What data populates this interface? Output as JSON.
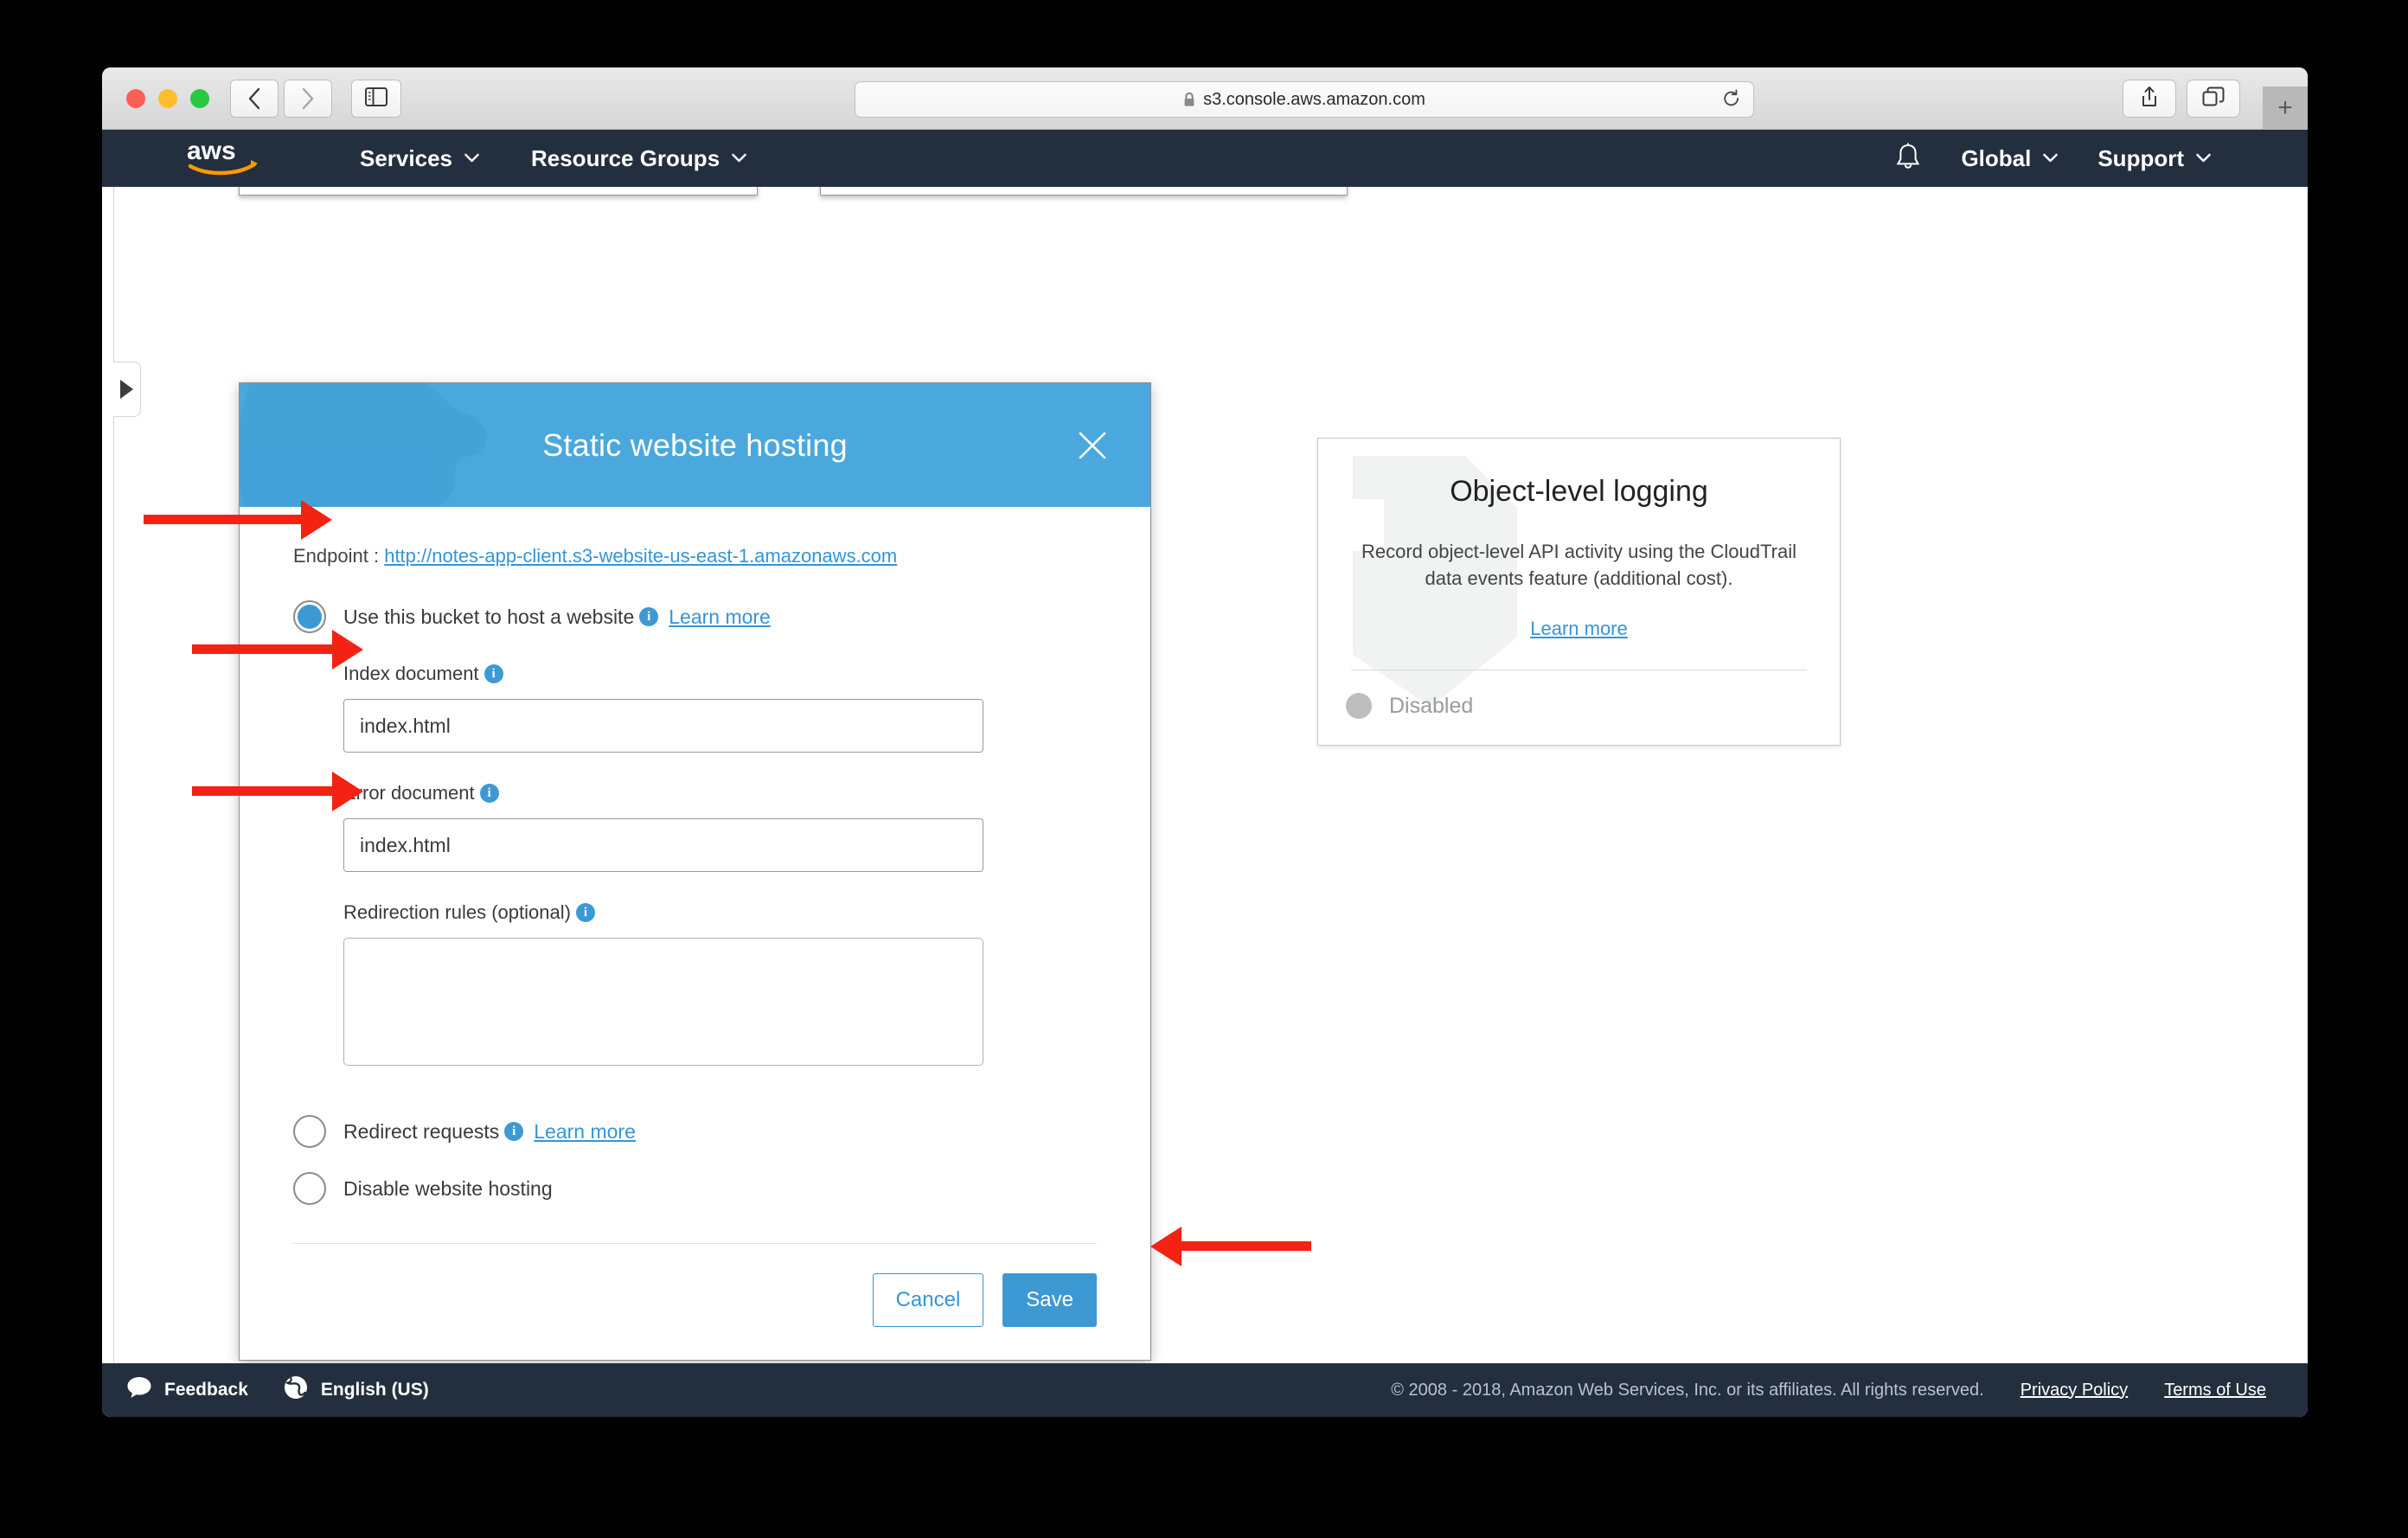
{
  "browser": {
    "url": "s3.console.aws.amazon.com",
    "lock_icon": "lock-icon",
    "reload_icon": "reload-icon",
    "back_icon": "chevron-left-icon",
    "forward_icon": "chevron-right-icon",
    "sidebar_icon": "sidebar-toggle-icon",
    "share_icon": "share-icon",
    "tabs_icon": "show-all-tabs-icon",
    "newtab_label": "+"
  },
  "awsnav": {
    "logo": "aws-logo",
    "services": "Services",
    "resource_groups": "Resource Groups",
    "bell_icon": "bell-icon",
    "region": "Global",
    "support": "Support",
    "caret": "⌄"
  },
  "modal": {
    "title": "Static website hosting",
    "close_icon": "close-icon",
    "endpoint_label": "Endpoint :",
    "endpoint_url": "http://notes-app-client.s3-website-us-east-1.amazonaws.com",
    "options": [
      {
        "label": "Use this bucket to host a website",
        "info_icon": "info-icon",
        "learn_more": "Learn more",
        "selected": true
      },
      {
        "label": "Redirect requests",
        "info_icon": "info-icon",
        "learn_more": "Learn more",
        "selected": false
      },
      {
        "label": "Disable website hosting",
        "info_icon": null,
        "learn_more": null,
        "selected": false
      }
    ],
    "index_document": {
      "label": "Index document",
      "value": "index.html",
      "placeholder": "index.html"
    },
    "error_document": {
      "label": "Error document",
      "value": "index.html",
      "placeholder": "index.html"
    },
    "redirection_rules": {
      "label": "Redirection rules (optional)",
      "value": "",
      "placeholder": ""
    },
    "cancel_label": "Cancel",
    "save_label": "Save",
    "header_color": "#4aa8dd",
    "accent_color": "#3d99d3",
    "link_color": "#3495d8"
  },
  "object_logging": {
    "title": "Object-level logging",
    "description": "Record object-level API activity using the CloudTrail data events feature (additional cost).",
    "learn_more": "Learn more",
    "status": "Disabled",
    "status_color": "#bdbdbd"
  },
  "footer": {
    "feedback": "Feedback",
    "feedback_icon": "speech-bubble-icon",
    "language": "English (US)",
    "language_icon": "globe-icon",
    "copyright": "© 2008 - 2018, Amazon Web Services, Inc. or its affiliates. All rights reserved.",
    "privacy_policy": "Privacy Policy",
    "terms_of_use": "Terms of Use"
  },
  "annotations": {
    "arrow_color": "#f42212",
    "arrows": [
      {
        "name": "arrow-to-host-website-radio",
        "direction": "right"
      },
      {
        "name": "arrow-to-index-document-input",
        "direction": "right"
      },
      {
        "name": "arrow-to-error-document-input",
        "direction": "right"
      },
      {
        "name": "arrow-to-save-button",
        "direction": "left"
      }
    ]
  }
}
